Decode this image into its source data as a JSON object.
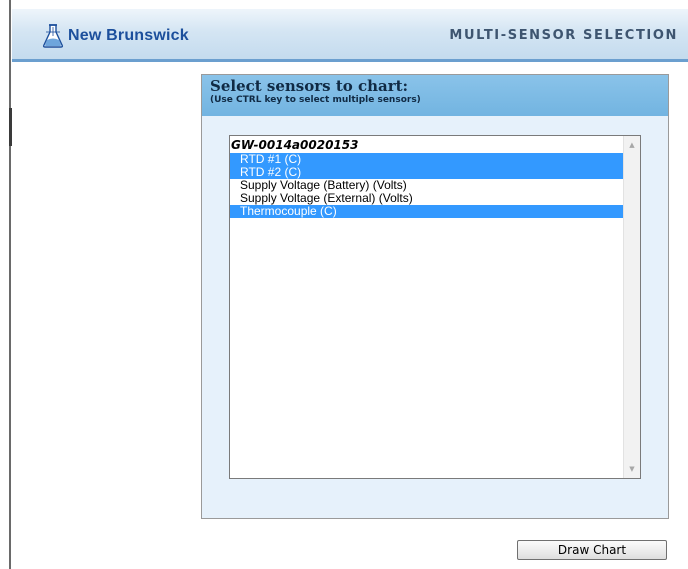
{
  "header": {
    "logo_icon": "flask-icon",
    "brand": "New Brunswick",
    "title": "MULTI-SENSOR SELECTION"
  },
  "panel": {
    "title": "Select sensors to chart:",
    "subtitle": "(Use CTRL key to select multiple sensors)"
  },
  "sensor_list": {
    "group": "GW-0014a0020153",
    "options": [
      {
        "label": "RTD #1 (C)",
        "selected": true
      },
      {
        "label": "RTD #2 (C)",
        "selected": true
      },
      {
        "label": "Supply Voltage (Battery) (Volts)",
        "selected": false
      },
      {
        "label": "Supply Voltage (External) (Volts)",
        "selected": false
      },
      {
        "label": "Thermocouple (C)",
        "selected": true
      }
    ]
  },
  "actions": {
    "draw_chart_label": "Draw Chart"
  },
  "colors": {
    "selection": "#3399ff",
    "header_accent": "#6b9fcf",
    "panel_header": "#7ab9e4",
    "panel_body": "#e6f1fb",
    "brand_text": "#1c4f9c"
  }
}
